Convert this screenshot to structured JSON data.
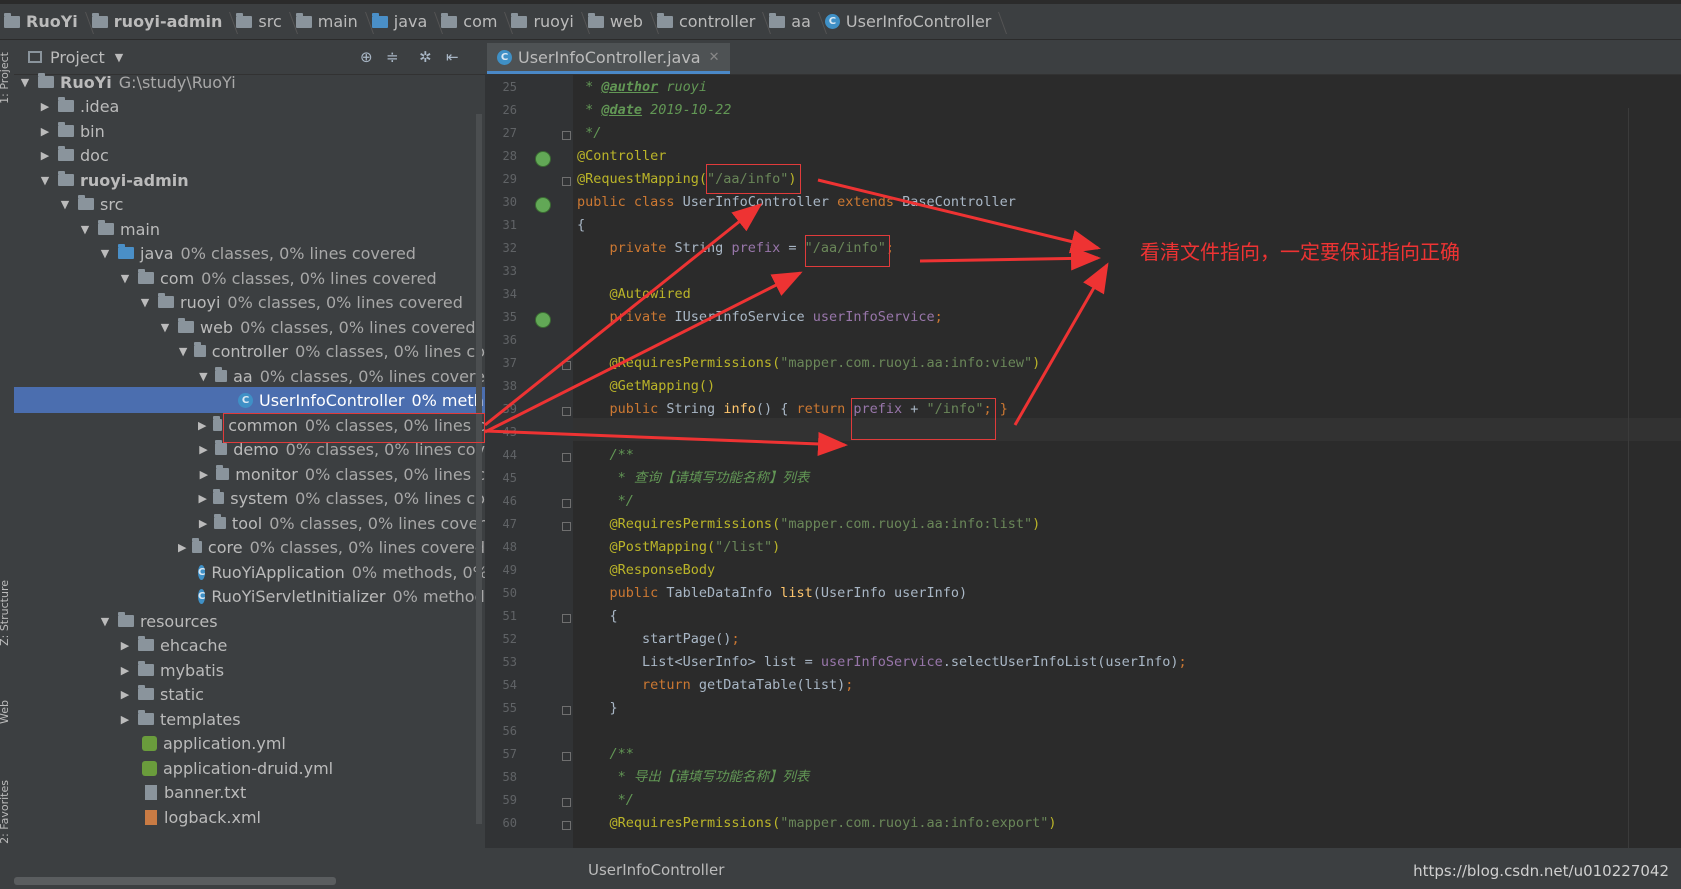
{
  "breadcrumb": [
    "RuoYi",
    "ruoyi-admin",
    "src",
    "main",
    "java",
    "com",
    "ruoyi",
    "web",
    "controller",
    "aa",
    "UserInfoController"
  ],
  "project_panel": {
    "title": "Project"
  },
  "side_tabs": {
    "project": "1: Project",
    "structure": "Z: Structure",
    "web": "Web",
    "favorites": "2: Favorites"
  },
  "tree": [
    {
      "label": "RuoYi",
      "suffix": "G:\\study\\RuoYi"
    },
    {
      "label": ".idea",
      "suffix": ""
    },
    {
      "label": "bin",
      "suffix": ""
    },
    {
      "label": "doc",
      "suffix": ""
    },
    {
      "label": "ruoyi-admin",
      "suffix": ""
    },
    {
      "label": "src",
      "suffix": ""
    },
    {
      "label": "main",
      "suffix": ""
    },
    {
      "label": "java",
      "suffix": "0% classes, 0% lines covered"
    },
    {
      "label": "com",
      "suffix": "0% classes, 0% lines covered"
    },
    {
      "label": "ruoyi",
      "suffix": "0% classes, 0% lines covered"
    },
    {
      "label": "web",
      "suffix": "0% classes, 0% lines covered"
    },
    {
      "label": "controller",
      "suffix": "0% classes, 0% lines co"
    },
    {
      "label": "aa",
      "suffix": "0% classes, 0% lines covere"
    },
    {
      "label": "UserInfoController",
      "suffix": "0% meth"
    },
    {
      "label": "common",
      "suffix": "0% classes, 0% lines c"
    },
    {
      "label": "demo",
      "suffix": "0% classes, 0% lines cov"
    },
    {
      "label": "monitor",
      "suffix": "0% classes, 0% lines c"
    },
    {
      "label": "system",
      "suffix": "0% classes, 0% lines co"
    },
    {
      "label": "tool",
      "suffix": "0% classes, 0% lines cover"
    },
    {
      "label": "core",
      "suffix": "0% classes, 0% lines covered"
    },
    {
      "label": "RuoYiApplication",
      "suffix": "0% methods, 0% li"
    },
    {
      "label": "RuoYiServletInitializer",
      "suffix": "0% methods, 0"
    },
    {
      "label": "resources",
      "suffix": ""
    },
    {
      "label": "ehcache",
      "suffix": ""
    },
    {
      "label": "mybatis",
      "suffix": ""
    },
    {
      "label": "static",
      "suffix": ""
    },
    {
      "label": "templates",
      "suffix": ""
    },
    {
      "label": "application.yml",
      "suffix": ""
    },
    {
      "label": "application-druid.yml",
      "suffix": ""
    },
    {
      "label": "banner.txt",
      "suffix": ""
    },
    {
      "label": "logback.xml",
      "suffix": ""
    }
  ],
  "editor": {
    "tab_label": "UserInfoController.java",
    "line_numbers": [
      "25",
      "26",
      "27",
      "28",
      "29",
      "30",
      "31",
      "32",
      "33",
      "34",
      "35",
      "36",
      "37",
      "38",
      "39",
      "43",
      "44",
      "45",
      "46",
      "47",
      "48",
      "49",
      "50",
      "51",
      "52",
      "53",
      "54",
      "55",
      "56",
      "57",
      "58",
      "59",
      "60"
    ],
    "code": {
      "l25a": " * ",
      "l25b": "@author",
      "l25c": " ruoyi",
      "l26a": " * ",
      "l26b": "@date",
      "l26c": " 2019-10-22",
      "l27": " */",
      "l28": "@Controller",
      "l29a": "@RequestMapping(",
      "l29b": "\"/aa/info\"",
      "l29c": ")",
      "l30a": "public class ",
      "l30b": "UserInfoController ",
      "l30c": "extends ",
      "l30d": "BaseController",
      "l31": "{",
      "l32a": "    private ",
      "l32b": "String ",
      "l32c": "prefix",
      "l32d": " = ",
      "l32e": "\"/aa/info\"",
      "l32f": ";",
      "l34": "    @Autowired",
      "l35a": "    private ",
      "l35b": "IUserInfoService ",
      "l35c": "userInfoService",
      "l35d": ";",
      "l37a": "    @RequiresPermissions(",
      "l37b": "\"mapper.com.ruoyi.aa:info:view\"",
      "l37c": ")",
      "l38": "    @GetMapping()",
      "l39a": "    public ",
      "l39b": "String ",
      "l39c": "info",
      "l39d": "() { ",
      "l39e": "return ",
      "l39f": "prefix",
      "l39g": " + ",
      "l39h": "\"/info\"",
      "l39i": "; }",
      "l44": "    /**",
      "l45": "     * 查询【请填写功能名称】列表",
      "l46": "     */",
      "l47a": "    @RequiresPermissions(",
      "l47b": "\"mapper.com.ruoyi.aa:info:list\"",
      "l47c": ")",
      "l48a": "    @PostMapping(",
      "l48b": "\"/list\"",
      "l48c": ")",
      "l49": "    @ResponseBody",
      "l50a": "    public ",
      "l50b": "TableDataInfo ",
      "l50c": "list",
      "l50d": "(UserInfo userInfo)",
      "l51": "    {",
      "l52a": "        startPage()",
      "l52b": ";",
      "l53a": "        List<UserInfo> list = ",
      "l53b": "userInfoService",
      ".l53c": "",
      "l53c": ".selectUserInfoList(userInfo)",
      "l53d": ";",
      "l54a": "        return ",
      "l54b": "getDataTable(list)",
      "l54c": ";",
      "l55": "    }",
      "l57": "    /**",
      "l58": "     * 导出【请填写功能名称】列表",
      "l59": "     */",
      "l60a": "    @RequiresPermissions(",
      "l60b": "\"mapper.com.ruoyi.aa:info:export\"",
      "l60c": ")"
    }
  },
  "annotation": {
    "note": "看清文件指向，一定要保证指向正确"
  },
  "status": {
    "class_name": "UserInfoController"
  },
  "watermark": "https://blog.csdn.net/u010227042",
  "colors": {
    "annotation_red": "#ee3333",
    "selection": "#4b6eaf"
  }
}
